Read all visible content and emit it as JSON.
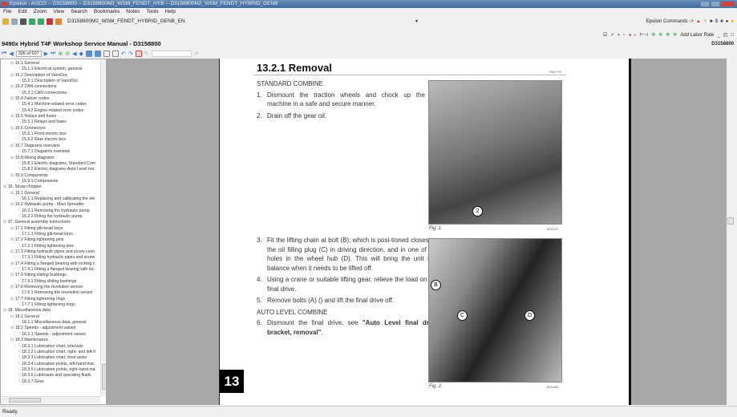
{
  "window": {
    "title": "Epsilon - AGCO -- D3158800 -- D3158800M2_WSM_FENDT_HYB -- D3158800M2_WSM_FENDT_HYBRID_GENB"
  },
  "menu": [
    "File",
    "Edit",
    "Zoom",
    "View",
    "Search",
    "Bookmarks",
    "Notes",
    "Tools",
    "Help"
  ],
  "toolbar": {
    "document": "D3158800M2_WSM_FENDT_HYBRID_GENB_EN",
    "epsilon_commands": "Epsilon Commands ->",
    "add_labor_rate": "Add Labor Rate",
    "doc_id": "D3158800"
  },
  "doc_title": "9490x Hybrid T4F Workshop Service Manual - D3158800",
  "nav": {
    "page": "326 of 697"
  },
  "tree": [
    {
      "l": 1,
      "t": "15.1 General"
    },
    {
      "l": 2,
      "t": "15.1.1 Electrical system, general"
    },
    {
      "l": 1,
      "t": "15.2 Description of VarioDoc"
    },
    {
      "l": 2,
      "t": "15.2.1 Description of VarioDoc"
    },
    {
      "l": 1,
      "t": "15.3 CAN connections"
    },
    {
      "l": 2,
      "t": "15.3.1 CAN connections"
    },
    {
      "l": 1,
      "t": "15.4 Failure codes"
    },
    {
      "l": 2,
      "t": "15.4.1 Machine-related error codes"
    },
    {
      "l": 2,
      "t": "15.4.2 Engine-related error codes"
    },
    {
      "l": 1,
      "t": "15.5 Relays and fuses"
    },
    {
      "l": 2,
      "t": "15.5.1 Relays and fuses"
    },
    {
      "l": 1,
      "t": "15.6 Connectors"
    },
    {
      "l": 2,
      "t": "15.6.1 Front electric box"
    },
    {
      "l": 2,
      "t": "15.6.2 Rear electric box"
    },
    {
      "l": 1,
      "t": "15.7 Diagrams overview"
    },
    {
      "l": 2,
      "t": "15.7.1 Diagrams overview"
    },
    {
      "l": 1,
      "t": "15.8 Wiring diagrams"
    },
    {
      "l": 2,
      "t": "15.8.1 Electric diagrams, Standard Com"
    },
    {
      "l": 2,
      "t": "15.8.2 Electric diagrams Auto Level ma"
    },
    {
      "l": 1,
      "t": "15.9 Components"
    },
    {
      "l": 2,
      "t": "15.9.1 Components"
    },
    {
      "l": 0,
      "t": "16. Straw chopper"
    },
    {
      "l": 1,
      "t": "16.1 General"
    },
    {
      "l": 2,
      "t": "16.1.1 Replacing and calibrating the ele"
    },
    {
      "l": 1,
      "t": "16.2 Hydraulic pump - Maxi Spreader"
    },
    {
      "l": 2,
      "t": "16.2.1 Removing the hydraulic pump"
    },
    {
      "l": 2,
      "t": "16.2.2 Fitting the hydraulic pump"
    },
    {
      "l": 0,
      "t": "17. General assembly instructions"
    },
    {
      "l": 1,
      "t": "17.1 Fitting gib-head keys"
    },
    {
      "l": 2,
      "t": "17.1.1 Fitting gib-head keys"
    },
    {
      "l": 1,
      "t": "17.2 Fitting tightening pins"
    },
    {
      "l": 2,
      "t": "17.2.1 Fitting tightening pins"
    },
    {
      "l": 1,
      "t": "17.3 Fitting hydraulic pipes and screw conn"
    },
    {
      "l": 2,
      "t": "17.3.1 Fitting hydraulic pipes and screw"
    },
    {
      "l": 1,
      "t": "17.4 Fitting a flanged bearing with locking c"
    },
    {
      "l": 2,
      "t": "17.4.1 Fitting a flanged bearing with loc"
    },
    {
      "l": 1,
      "t": "17.5 Fitting sliding bushings"
    },
    {
      "l": 2,
      "t": "17.5.1 Fitting sliding bushings"
    },
    {
      "l": 1,
      "t": "17.6 Removing the revolution sensor"
    },
    {
      "l": 2,
      "t": "17.6.1 Removing the revolution sensor"
    },
    {
      "l": 1,
      "t": "17.7 Fitting tightening rings"
    },
    {
      "l": 2,
      "t": "17.7.1 Fitting tightening rings"
    },
    {
      "l": 0,
      "t": "18. Miscellaneous data"
    },
    {
      "l": 1,
      "t": "18.1 General"
    },
    {
      "l": 2,
      "t": "18.1.1 Miscellaneous data, general"
    },
    {
      "l": 1,
      "t": "18.2 Speeds - adjustment values"
    },
    {
      "l": 2,
      "t": "18.2.1 Speeds - adjustment values"
    },
    {
      "l": 1,
      "t": "18.3 Maintenance"
    },
    {
      "l": 2,
      "t": "18.3.1 Lubrication chart, intervals"
    },
    {
      "l": 2,
      "t": "18.3.2 Lubrication chart, right- and left-h"
    },
    {
      "l": 2,
      "t": "18.3.3 Lubrication chart, front axles"
    },
    {
      "l": 2,
      "t": "18.3.4 Lubrication points, left-hand mac"
    },
    {
      "l": 2,
      "t": "18.3.5 Lubrication points, right-hand ma"
    },
    {
      "l": 2,
      "t": "18.3.6 Lubricants and operating fluids"
    },
    {
      "l": 2,
      "t": "18.3.7 Gear"
    }
  ],
  "page": {
    "heading": "13.2.1 Removal",
    "heading_code": "T9017?0",
    "section1": "STANDARD COMBINE",
    "steps1": [
      {
        "n": "1.",
        "t": "Dismount the traction wheels and chock up the machine in a safe and secure manner."
      },
      {
        "n": "2.",
        "t": "Drain off the gear oil."
      }
    ],
    "steps2": [
      {
        "n": "3.",
        "t": "Fit the lifting chain at bolt (B), which is posi-tioned closest to the oil filling plug (C) in driving direction, and in one of the holes in the wheel hub (D). This will bring the unit into balance when it needs to be lifted off."
      },
      {
        "n": "4.",
        "t": "Using a crane or suitable lifting gear, relieve the load on the final drive."
      },
      {
        "n": "5.",
        "t": "Remove bolts (A) () and lift the final drive off."
      }
    ],
    "section2": "AUTO LEVEL COMBINE",
    "step6": {
      "n": "6.",
      "pre": "Dismount the final drive, see ",
      "link": "\"Auto Level final drive bracket, removal\"",
      "post": "."
    },
    "fig1": {
      "caption": "Fig. 1.",
      "code": "I021477",
      "callouts": [
        "2"
      ]
    },
    "fig2": {
      "caption": "Fig. 2.",
      "code": "I021493",
      "callouts": [
        "B",
        "C",
        "D"
      ]
    },
    "chapter_tab": "13"
  },
  "status": "Ready"
}
